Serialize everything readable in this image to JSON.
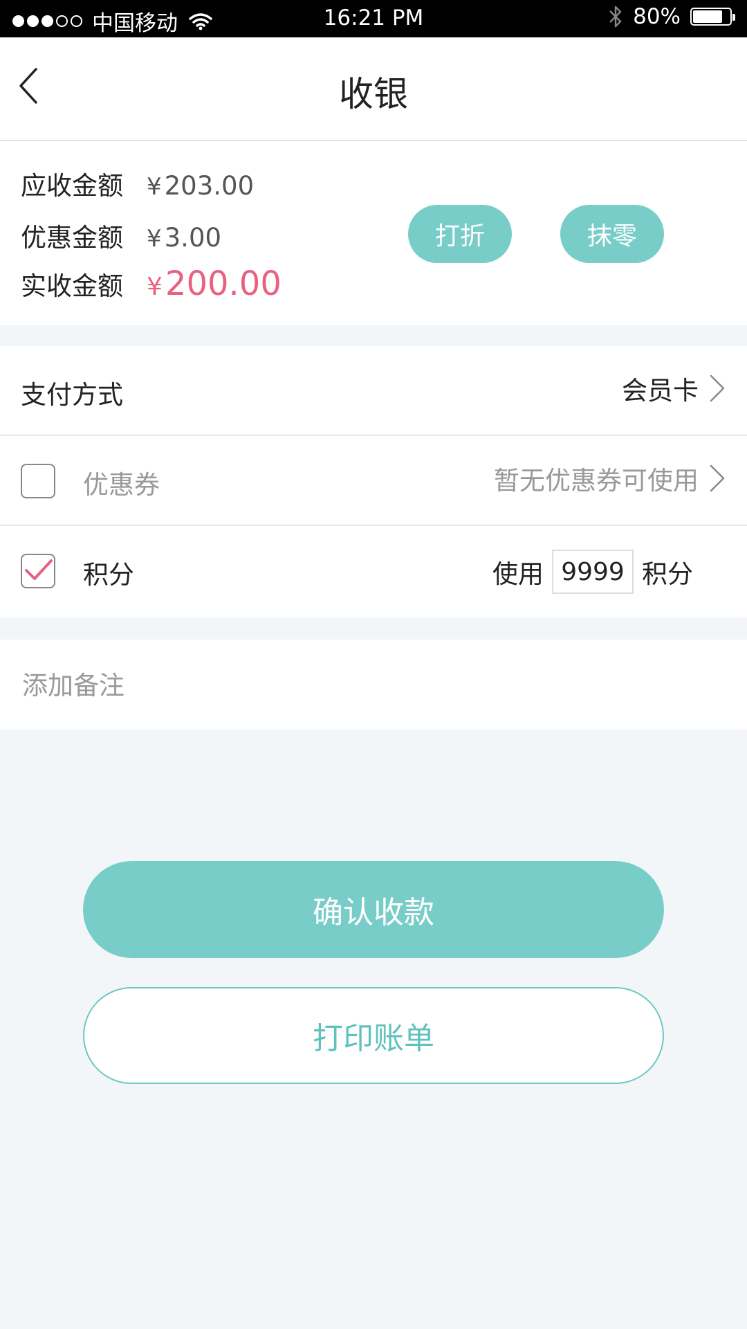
{
  "status_bar": {
    "carrier": "中国移动",
    "time": "16:21 PM",
    "battery": "80%",
    "battery_level": 0.8,
    "signal_bars_filled": 3,
    "signal_bars_total": 5
  },
  "header": {
    "title": "收银",
    "back_icon": "chevron-left-icon"
  },
  "amounts": {
    "receivable_label": "应收金额",
    "receivable_currency": "¥",
    "receivable_value": "203.00",
    "discount_label": "优惠金额",
    "discount_currency": "¥",
    "discount_value": "3.00",
    "actual_label": "实收金额",
    "actual_currency": "¥",
    "actual_value": "200.00",
    "discount_button": "打折",
    "round_button": "抹零"
  },
  "payment": {
    "label": "支付方式",
    "value": "会员卡"
  },
  "coupon": {
    "checked": false,
    "label": "优惠券",
    "value": "暂无优惠券可使用"
  },
  "points": {
    "checked": true,
    "label": "积分",
    "use_label": "使用",
    "amount": "9999",
    "unit": "积分"
  },
  "note": {
    "placeholder": "添加备注"
  },
  "actions": {
    "confirm": "确认收款",
    "print": "打印账单"
  },
  "colors": {
    "accent": "#78cdc9",
    "price_highlight": "#e8617e",
    "check_mark": "#e8617e"
  }
}
